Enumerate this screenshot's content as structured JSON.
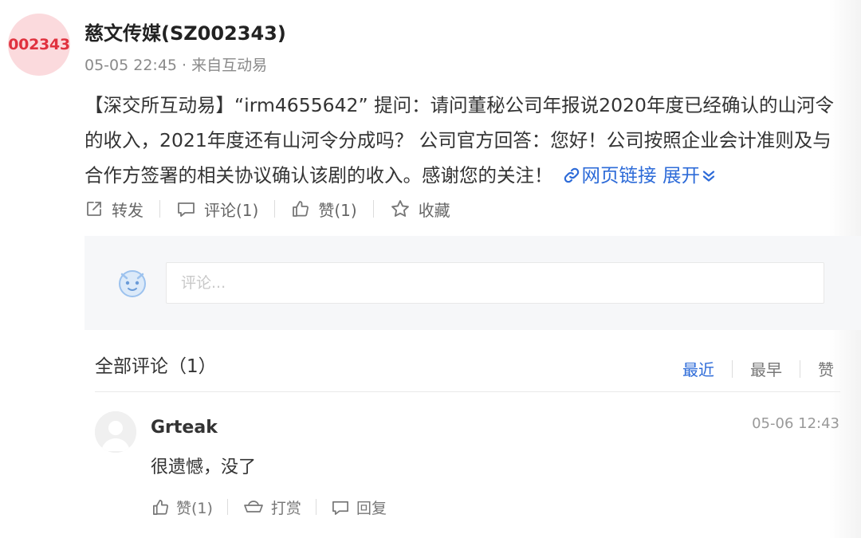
{
  "post": {
    "avatar_code": "002343",
    "title": "慈文传媒(SZ002343)",
    "meta": "05-05 22:45 · 来自互动易",
    "body": "【深交所互动易】“irm4655642” 提问：请问董秘公司年报说2020年度已经确认的山河令的收入，2021年度还有山河令分成吗？ 公司官方回答：您好！公司按照企业会计准则及与合作方签署的相关协议确认该剧的收入。感谢您的关注！",
    "web_link_label": "网页链接",
    "expand_label": "展开",
    "accent_color": "#2d6bd8"
  },
  "actions": {
    "forward": "转发",
    "comment": "评论(1)",
    "like": "赞(1)",
    "favorite": "收藏"
  },
  "comment_input": {
    "placeholder": "评论..."
  },
  "comments_section": {
    "header": "全部评论（1）",
    "sort_options": [
      "最近",
      "最早",
      "赞"
    ],
    "active_sort": "最近"
  },
  "comments": [
    {
      "user": "Grteak",
      "time": "05-06 12:43",
      "text": "很遗憾，没了",
      "actions": {
        "like": "赞(1)",
        "tip": "打赏",
        "reply": "回复"
      }
    }
  ]
}
